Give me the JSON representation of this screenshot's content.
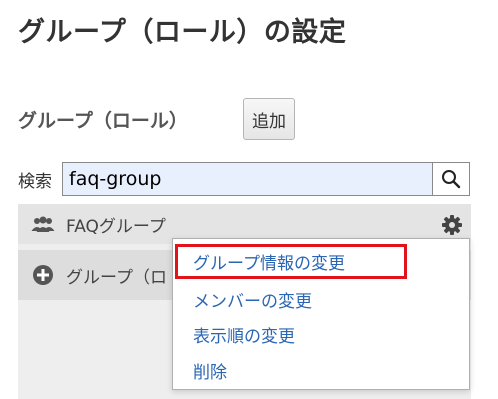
{
  "page": {
    "title": "グループ（ロール）の設定"
  },
  "groups_section": {
    "label": "グループ（ロール）",
    "add_button": "追加"
  },
  "search": {
    "label": "検索",
    "value": "faq-group",
    "button_icon": "search-icon"
  },
  "group_list": {
    "items": [
      {
        "label": "FAQグループ",
        "icon": "users-icon",
        "action_icon": "gear-icon"
      },
      {
        "label": "グループ（ロ",
        "icon": "plus-circle-icon"
      }
    ]
  },
  "context_menu": {
    "items": [
      {
        "label": "グループ情報の変更",
        "highlighted": true
      },
      {
        "label": "メンバーの変更"
      },
      {
        "label": "表示順の変更"
      },
      {
        "label": "削除"
      }
    ],
    "highlight_color": "#e0141a",
    "link_color": "#2a66b3"
  }
}
